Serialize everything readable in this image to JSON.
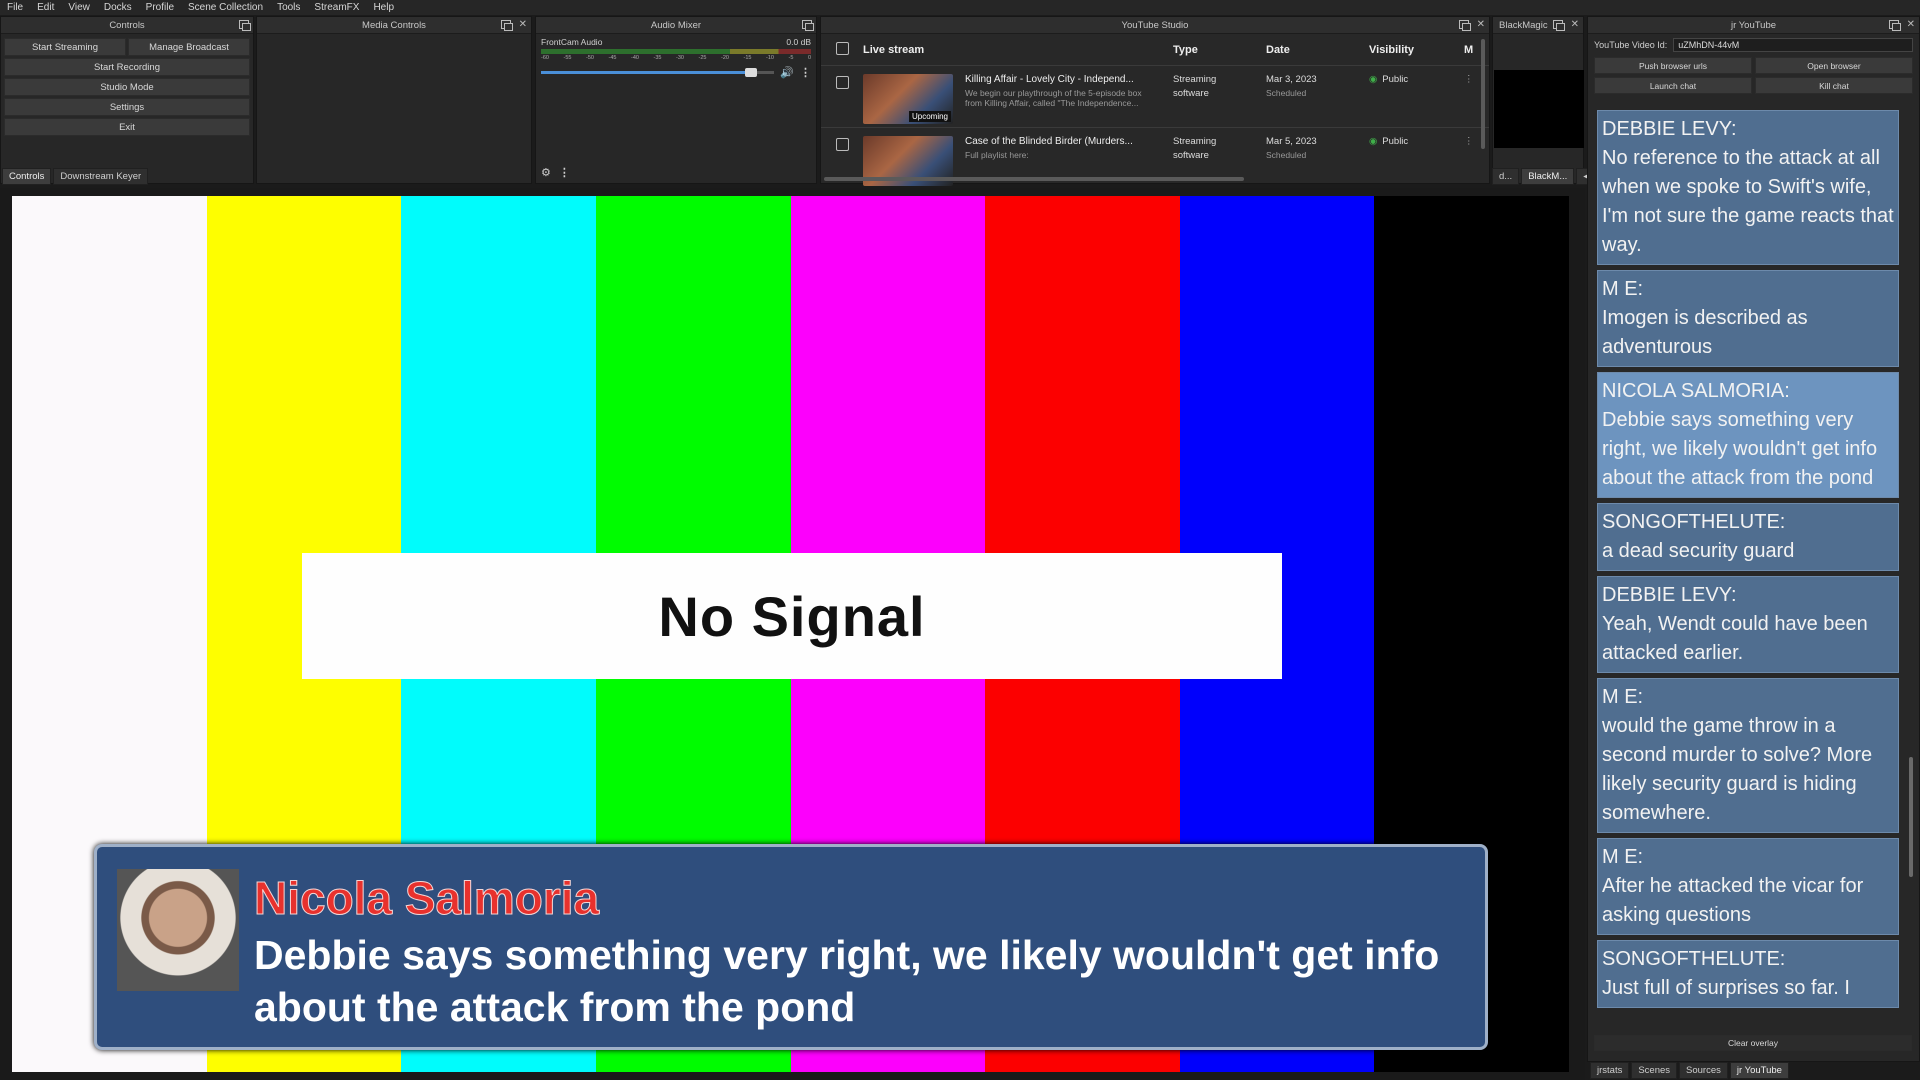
{
  "menu": [
    "File",
    "Edit",
    "View",
    "Docks",
    "Profile",
    "Scene Collection",
    "Tools",
    "StreamFX",
    "Help"
  ],
  "controls": {
    "title": "Controls",
    "start_streaming": "Start Streaming",
    "manage_broadcast": "Manage Broadcast",
    "start_recording": "Start Recording",
    "studio_mode": "Studio Mode",
    "settings": "Settings",
    "exit": "Exit",
    "tabs": [
      "Controls",
      "Downstream Keyer"
    ]
  },
  "media_controls": {
    "title": "Media Controls"
  },
  "audio_mixer": {
    "title": "Audio Mixer",
    "source": "FrontCam Audio",
    "level": "0.0 dB",
    "scale": [
      "-60",
      "-55",
      "-50",
      "-45",
      "-40",
      "-35",
      "-30",
      "-25",
      "-20",
      "-15",
      "-10",
      "-5",
      "0"
    ],
    "volume": 0.9
  },
  "youtube_studio": {
    "title": "YouTube Studio",
    "headers": {
      "live": "Live stream",
      "type": "Type",
      "date": "Date",
      "visibility": "Visibility",
      "more": "M"
    },
    "rows": [
      {
        "title": "Killing Affair - Lovely City - Independ...",
        "desc1": "We begin our playthrough of the 5-episode box",
        "desc2": "from Killing Affair, called \"The Independence...",
        "badge": "Upcoming",
        "type1": "Streaming",
        "type2": "software",
        "date": "Mar 3, 2023",
        "status": "Scheduled",
        "visibility": "Public"
      },
      {
        "title": "Case of the Blinded Birder (Murders...",
        "desc1": "Full playlist here:",
        "desc2": "",
        "badge": "",
        "type1": "Streaming",
        "type2": "software",
        "date": "Mar 5, 2023",
        "status": "Scheduled",
        "visibility": "Public"
      }
    ]
  },
  "blackmagic": {
    "title": "BlackMagic",
    "tabs": [
      "d...",
      "BlackM..."
    ]
  },
  "jr_youtube": {
    "title": "jr YouTube",
    "video_id_label": "YouTube Video Id:",
    "video_id": "uZMhDN-44vM",
    "push_urls": "Push browser urls",
    "open_browser": "Open browser",
    "launch_chat": "Launch chat",
    "kill_chat": "Kill chat",
    "clear_overlay": "Clear overlay",
    "messages": [
      {
        "author": "DEBBIE LEVY:",
        "text": "No reference to the attack at all when we spoke to Swift's wife, I'm not sure the game reacts that way.",
        "highlight": false
      },
      {
        "author": "M E:",
        "text": "Imogen is described as adventurous",
        "highlight": false
      },
      {
        "author": "NICOLA SALMORIA:",
        "text": "Debbie says something very right, we likely wouldn't get info about the attack from the pond",
        "highlight": true
      },
      {
        "author": "SONGOFTHELUTE:",
        "text": "a dead security guard",
        "highlight": false
      },
      {
        "author": "DEBBIE LEVY:",
        "text": "Yeah, Wendt could have been attacked earlier.",
        "highlight": false
      },
      {
        "author": "M E:",
        "text": "would the game throw in a second murder to solve? More likely security guard is hiding somewhere.",
        "highlight": false
      },
      {
        "author": "M E:",
        "text": "After he attacked the vicar for asking questions",
        "highlight": false
      },
      {
        "author": "SONGOFTHELUTE:",
        "text": "Just full of surprises so far. I",
        "highlight": false
      }
    ]
  },
  "bottom_tabs": [
    "jrstats",
    "Scenes",
    "Sources",
    "jr YouTube"
  ],
  "preview": {
    "bar_colors": [
      "#fbf9fb",
      "#fefe00",
      "#00fcfc",
      "#00fc00",
      "#fc00fc",
      "#fc0000",
      "#0000fc",
      "#000000"
    ],
    "no_signal": "No Signal"
  },
  "overlay": {
    "name": "Nicola Salmoria",
    "message": "Debbie says something very right, we likely wouldn't get info about the attack from the pond"
  }
}
